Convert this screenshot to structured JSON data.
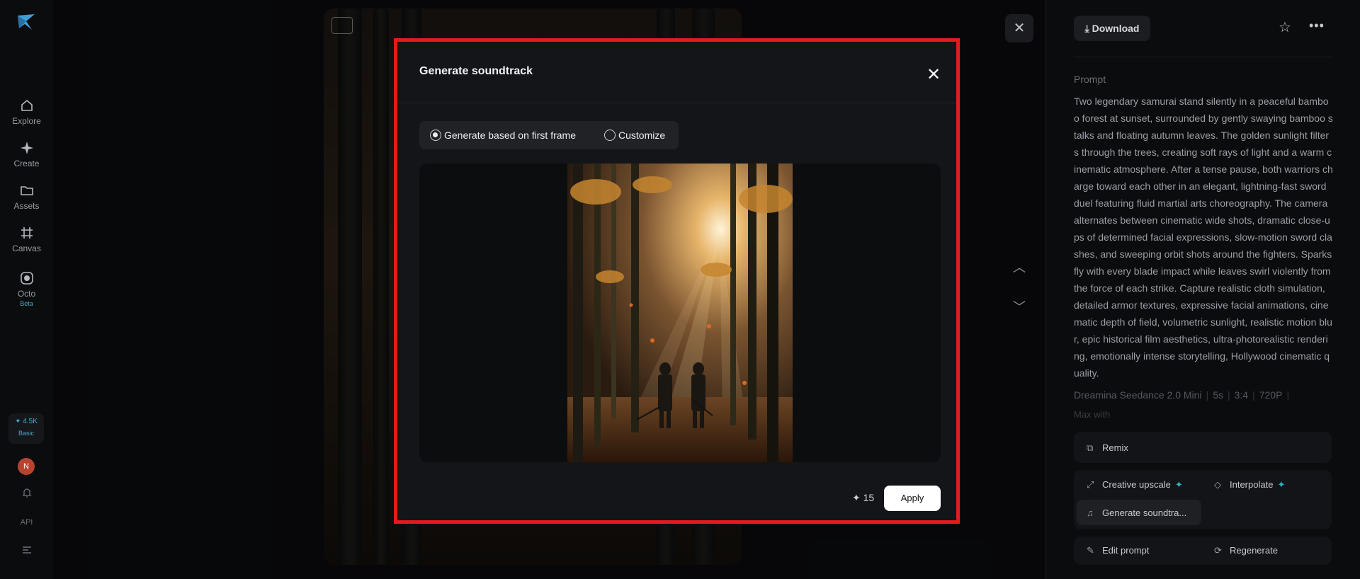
{
  "sidebar": {
    "items": [
      {
        "label": "Explore",
        "icon": "home-icon"
      },
      {
        "label": "Create",
        "icon": "sparkle-icon"
      },
      {
        "label": "Assets",
        "icon": "folder-icon"
      },
      {
        "label": "Canvas",
        "icon": "canvas-icon"
      },
      {
        "label": "Octo",
        "icon": "octo-icon",
        "badge": "Beta"
      }
    ],
    "credits": {
      "value": "4.5K",
      "plan": "Basic"
    },
    "avatar_initial": "N",
    "api_label": "API"
  },
  "detail": {
    "download_label": "Download",
    "prompt_label": "Prompt",
    "prompt_text": "Two legendary samurai stand silently in a peaceful bamboo forest at sunset, surrounded by gently swaying bamboo stalks and floating autumn leaves. The golden sunlight filters through the trees, creating soft rays of light and a warm cinematic atmosphere. After a tense pause, both warriors charge toward each other in an elegant, lightning-fast sword duel featuring fluid martial arts choreography. The camera alternates between cinematic wide shots, dramatic close-ups of determined facial expressions, slow-motion sword clashes, and sweeping orbit shots around the fighters. Sparks fly with every blade impact while leaves swirl violently from the force of each strike. Capture realistic cloth simulation, detailed armor textures, expressive facial animations, cinematic depth of field, volumetric sunlight, realistic motion blur, epic historical film aesthetics, ultra-photorealistic rendering, emotionally intense storytelling, Hollywood cinematic quality.",
    "meta": [
      "Dreamina Seedance 2.0 Mini",
      "5s",
      "3:4",
      "720P"
    ],
    "meta_more": "Max with",
    "actions": {
      "remix": "Remix",
      "creative_upscale": "Creative upscale",
      "interpolate": "Interpolate",
      "generate_soundtrack": "Generate soundtra...",
      "edit_prompt": "Edit prompt",
      "regenerate": "Regenerate"
    }
  },
  "modal": {
    "title": "Generate soundtrack",
    "options": [
      "Generate based on first frame",
      "Customize"
    ],
    "selected_option": "Generate based on first frame",
    "cost": "15",
    "apply_label": "Apply"
  },
  "colors": {
    "accent": "#2fb7c9",
    "highlight_border": "#e21b1b"
  }
}
